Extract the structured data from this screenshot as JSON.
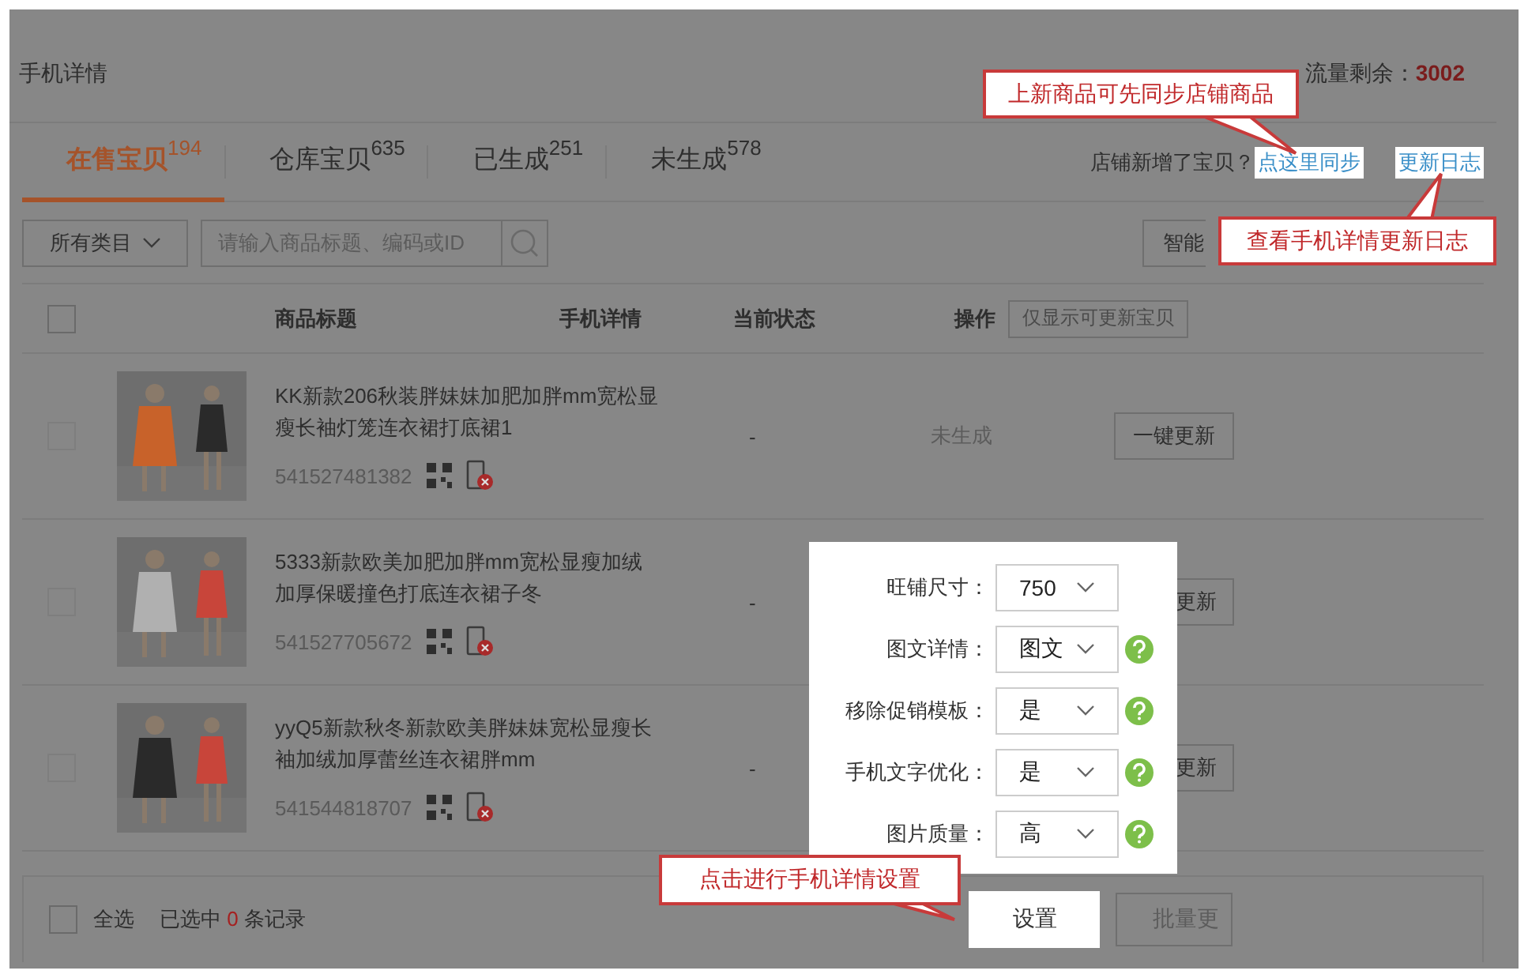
{
  "header": {
    "title": "手机详情",
    "traffic_label": "流量剩余：",
    "traffic_value": "3002"
  },
  "tabs": [
    {
      "label": "在售宝贝",
      "count": "194",
      "selected": true
    },
    {
      "label": "仓库宝贝",
      "count": "635",
      "selected": false
    },
    {
      "label": "已生成",
      "count": "251",
      "selected": false
    },
    {
      "label": "未生成",
      "count": "578",
      "selected": false
    }
  ],
  "sync": {
    "prompt": "店铺新增了宝贝？",
    "link": "点这里同步",
    "log_link": "更新日志"
  },
  "filter": {
    "category": "所有类目",
    "search_placeholder": "请输入商品标题、编码或ID",
    "smart_button": "智能"
  },
  "table": {
    "all_checked": false,
    "columns": [
      "商品标题",
      "手机详情",
      "当前状态",
      "操作"
    ],
    "filter_button": "仅显示可更新宝贝",
    "rows": [
      {
        "title": "KK新款206秋装胖妹妹加肥加胖mm宽松显瘦长袖灯笼连衣裙打底裙1",
        "id": "541527481382",
        "detail": "-",
        "status": "未生成",
        "action": "一键更新",
        "checked": false
      },
      {
        "title": "5333新款欧美加肥加胖mm宽松显瘦加绒加厚保暖撞色打底连衣裙子冬",
        "id": "541527705672",
        "detail": "-",
        "action": "更新",
        "checked": false
      },
      {
        "title": "yyQ5新款秋冬新款欧美胖妹妹宽松显瘦长袖加绒加厚蕾丝连衣裙胖mm",
        "id": "541544818707",
        "detail": "-",
        "action": "更新",
        "checked": false
      }
    ]
  },
  "footer": {
    "checked": false,
    "select_all": "全选",
    "selected_text": "已选中 ",
    "selected_count": "0",
    "selected_suffix": " 条记录",
    "set_button": "设置",
    "batch_button": "批量更"
  },
  "settings": [
    {
      "label": "旺铺尺寸：",
      "value": "750",
      "help": false
    },
    {
      "label": "图文详情：",
      "value": "图文",
      "help": true
    },
    {
      "label": "移除促销模板：",
      "value": "是",
      "help": true
    },
    {
      "label": "手机文字优化：",
      "value": "是",
      "help": true
    },
    {
      "label": "图片质量：",
      "value": "高",
      "help": true
    }
  ],
  "callouts": [
    "上新商品可先同步店铺商品",
    "查看手机详情更新日志",
    "点击进行手机详情设置"
  ]
}
